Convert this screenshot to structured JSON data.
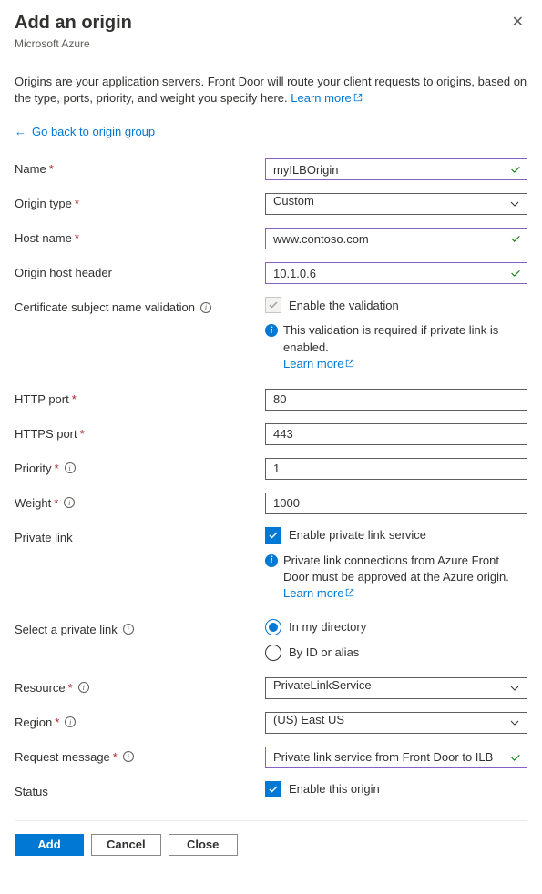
{
  "header": {
    "title": "Add an origin",
    "subtitle": "Microsoft Azure"
  },
  "description": {
    "text": "Origins are your application servers. Front Door will route your client requests to origins, based on the type, ports, priority, and weight you specify here. ",
    "learn_more": "Learn more"
  },
  "back_link": "Go back to origin group",
  "form": {
    "name": {
      "label": "Name",
      "value": "myILBOrigin"
    },
    "origin_type": {
      "label": "Origin type",
      "value": "Custom"
    },
    "host_name": {
      "label": "Host name",
      "value": "www.contoso.com"
    },
    "host_header": {
      "label": "Origin host header",
      "value": "10.1.0.6"
    },
    "cert_validation": {
      "label": "Certificate subject name validation",
      "checkbox_label": "Enable the validation",
      "help": "This validation is required if private link is enabled. ",
      "learn_more": "Learn more"
    },
    "http_port": {
      "label": "HTTP port",
      "value": "80"
    },
    "https_port": {
      "label": "HTTPS port",
      "value": "443"
    },
    "priority": {
      "label": "Priority",
      "value": "1"
    },
    "weight": {
      "label": "Weight",
      "value": "1000"
    },
    "private_link": {
      "label": "Private link",
      "checkbox_label": "Enable private link service",
      "help": "Private link connections from Azure Front Door must be approved at the Azure origin. ",
      "learn_more": "Learn more"
    },
    "select_private_link": {
      "label": "Select a private link",
      "option1": "In my directory",
      "option2": "By ID or alias"
    },
    "resource": {
      "label": "Resource",
      "value": "PrivateLinkService"
    },
    "region": {
      "label": "Region",
      "value": "(US) East US"
    },
    "request_message": {
      "label": "Request message",
      "value": "Private link service from Front Door to ILB"
    },
    "status": {
      "label": "Status",
      "checkbox_label": "Enable this origin"
    }
  },
  "buttons": {
    "add": "Add",
    "cancel": "Cancel",
    "close": "Close"
  }
}
